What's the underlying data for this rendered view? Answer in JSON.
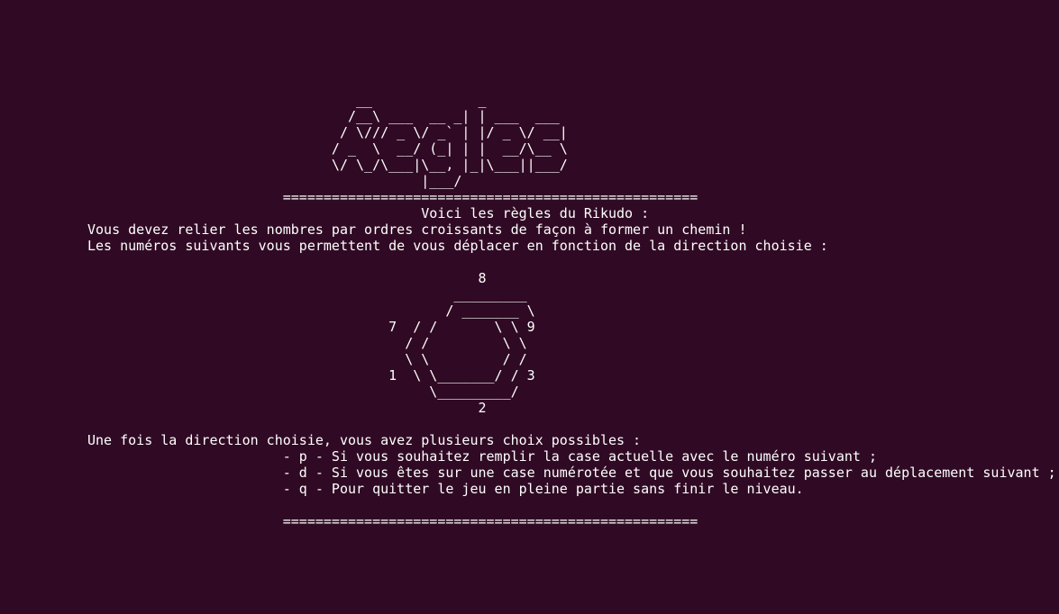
{
  "terminal": {
    "colors": {
      "background": "#300a24",
      "text": "#ffffff"
    },
    "lines": [
      "                                 __             _",
      "                                /__\\ ___  __ _| | ___  ___",
      "                               / \\/// _ \\/ _` | |/ _ \\/ __|",
      "                              / _  \\  __/ (_| | |  __/\\__ \\",
      "                              \\/ \\_/\\___|\\__, |_|\\___||___/",
      "                                         |___/",
      "                        ===================================================",
      "                                         Voici les règles du Rikudo :",
      "Vous devez relier les nombres par ordres croissants de façon à former un chemin !",
      "Les numéros suivants vous permettent de vous déplacer en fonction de la direction choisie :",
      "",
      "                                                8",
      "                                             _________",
      "                                            / _______ \\",
      "                                     7  / /       \\ \\ 9",
      "                                       / /         \\ \\",
      "                                       \\ \\         / /",
      "                                     1  \\ \\_______/ / 3",
      "                                          \\_________/",
      "                                                2",
      "",
      "Une fois la direction choisie, vous avez plusieurs choix possibles :",
      "                        - p - Si vous souhaitez remplir la case actuelle avec le numéro suivant ;",
      "                        - d - Si vous êtes sur une case numérotée et que vous souhaitez passer au déplacement suivant ;",
      "                        - q - Pour quitter le jeu en pleine partie sans finir le niveau.",
      "",
      "                        ==================================================="
    ]
  }
}
